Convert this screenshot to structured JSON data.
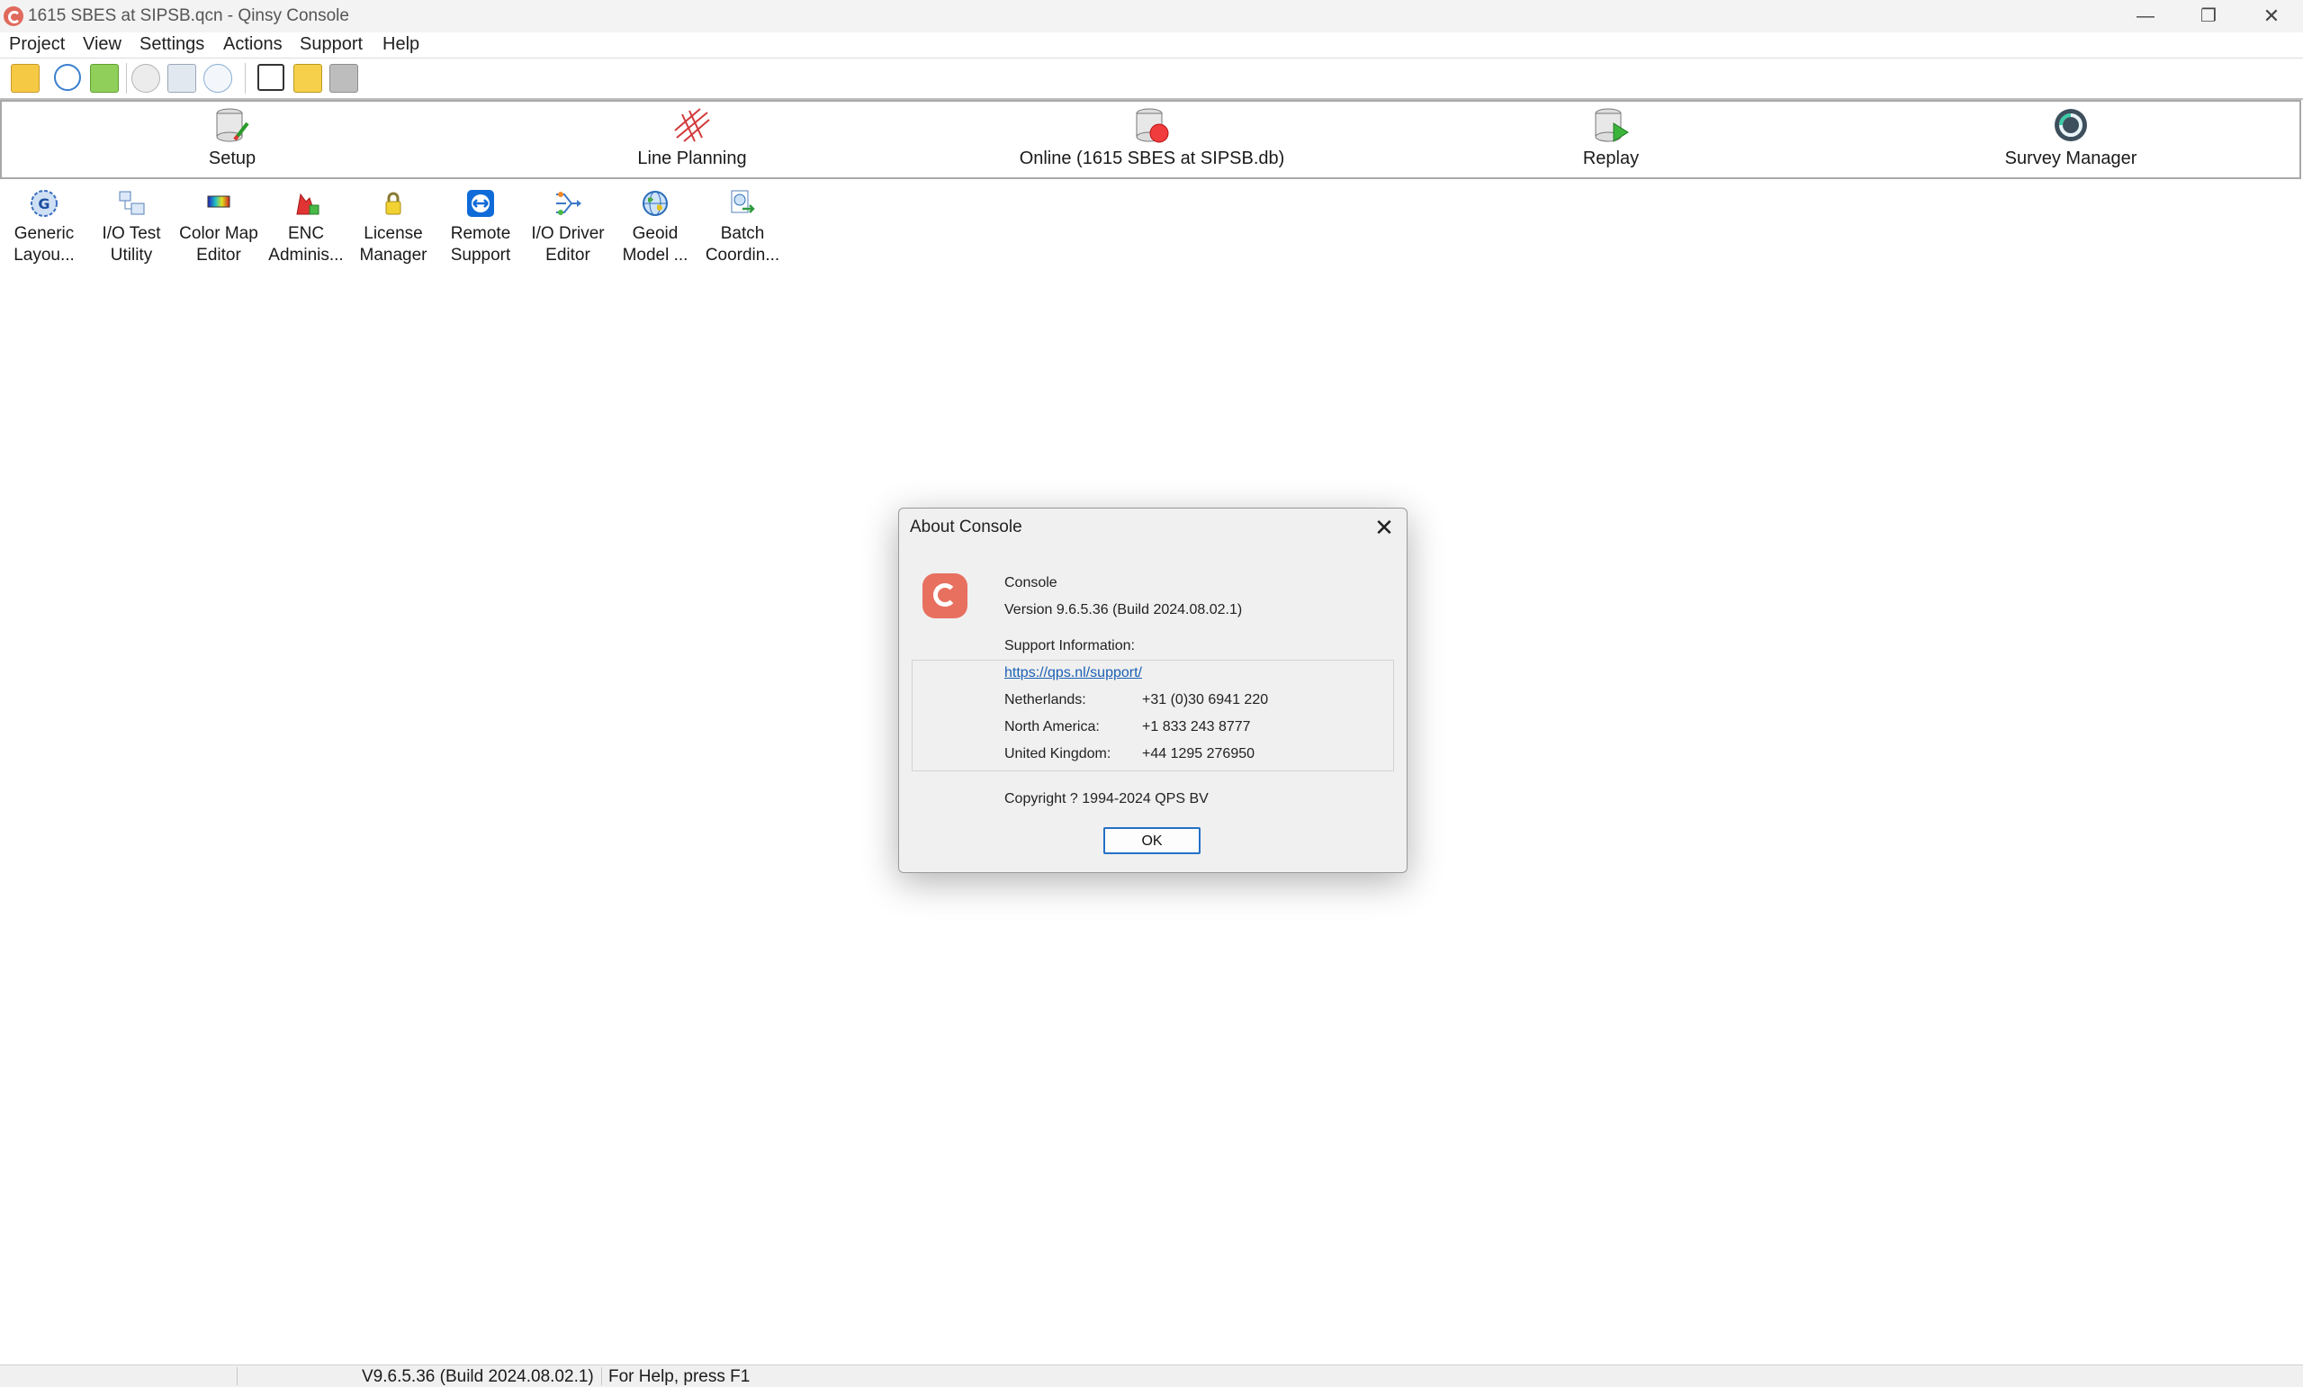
{
  "window": {
    "title": "1615 SBES at SIPSB.qcn - Qinsy Console",
    "minimize_glyph": "—",
    "maximize_glyph": "❐",
    "close_glyph": "✕"
  },
  "menu": [
    "Project",
    "View",
    "Settings",
    "Actions",
    "Support",
    "Help"
  ],
  "toolbar": {
    "icons": [
      "open-folder-icon",
      "globe-icon",
      "folder-green-icon",
      "brain-icon",
      "io-icon",
      "info-icon",
      "text-frame-icon",
      "yellow-page-icon",
      "gray-page-icon"
    ]
  },
  "workflow": [
    {
      "label": "Setup",
      "icon": "setup-database-icon"
    },
    {
      "label": "Line Planning",
      "icon": "line-planning-icon"
    },
    {
      "label": "Online (1615 SBES at SIPSB.db)",
      "icon": "online-database-icon"
    },
    {
      "label": "Replay",
      "icon": "replay-database-icon"
    },
    {
      "label": "Survey Manager",
      "icon": "survey-manager-icon"
    }
  ],
  "tools": [
    {
      "label": "Generic\nLayou...",
      "icon": "generic-layout-icon"
    },
    {
      "label": "I/O Test\nUtility",
      "icon": "io-test-icon"
    },
    {
      "label": "Color Map\nEditor",
      "icon": "color-map-icon"
    },
    {
      "label": "ENC\nAdminis...",
      "icon": "enc-admin-icon"
    },
    {
      "label": "License\nManager",
      "icon": "license-lock-icon"
    },
    {
      "label": "Remote\nSupport",
      "icon": "remote-support-icon"
    },
    {
      "label": "I/O Driver\nEditor",
      "icon": "io-driver-icon"
    },
    {
      "label": "Geoid\nModel ...",
      "icon": "geoid-globe-icon"
    },
    {
      "label": "Batch\nCoordin...",
      "icon": "batch-coordinate-icon"
    }
  ],
  "dialog": {
    "title": "About Console",
    "close_glyph": "✕",
    "product": "Console",
    "version": "Version 9.6.5.36 (Build 2024.08.02.1)",
    "support_heading": "Support Information:",
    "support_url": "https://qps.nl/support/",
    "contacts": [
      {
        "region": "Netherlands:",
        "phone": "+31 (0)30 6941 220"
      },
      {
        "region": "North America:",
        "phone": "+1 833 243 8777"
      },
      {
        "region": "United Kingdom:",
        "phone": "+44 1295 276950"
      }
    ],
    "copyright": "Copyright ? 1994-2024 QPS BV",
    "ok_label": "OK"
  },
  "status": {
    "version": "V9.6.5.36 (Build 2024.08.02.1)",
    "help": "For Help, press F1"
  },
  "colors": {
    "accent_blue": "#2470c6",
    "link": "#1a5fb4",
    "brand_red": "#e8705f"
  }
}
